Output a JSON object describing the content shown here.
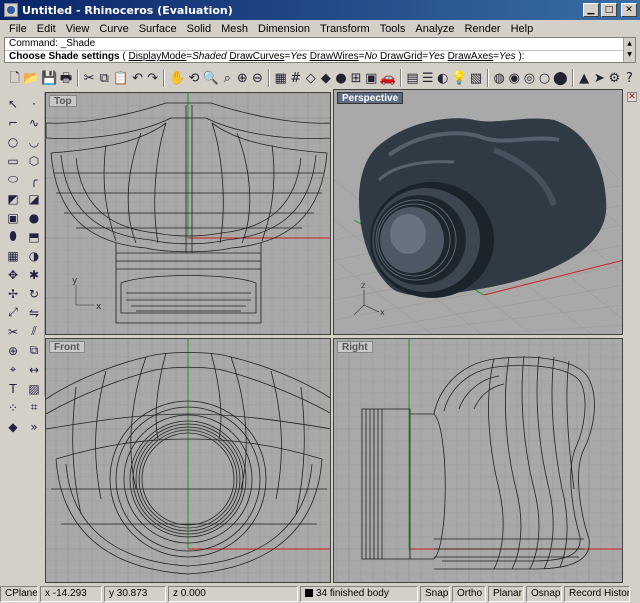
{
  "window": {
    "title": "Untitled - Rhinoceros (Evaluation)"
  },
  "menu": [
    "File",
    "Edit",
    "View",
    "Curve",
    "Surface",
    "Solid",
    "Mesh",
    "Dimension",
    "Transform",
    "Tools",
    "Analyze",
    "Render",
    "Help"
  ],
  "command": {
    "history": "Command: _Shade",
    "prompt_label": "Choose Shade settings",
    "options": [
      {
        "name": "DisplayMode",
        "value": "Shaded"
      },
      {
        "name": "DrawCurves",
        "value": "Yes"
      },
      {
        "name": "DrawWires",
        "value": "No"
      },
      {
        "name": "DrawGrid",
        "value": "Yes"
      },
      {
        "name": "DrawAxes",
        "value": "Yes"
      }
    ]
  },
  "toolbar": {
    "icons": [
      "new-icon",
      "open-icon",
      "save-icon",
      "print-icon",
      "sep",
      "cut-icon",
      "copy-icon",
      "paste-icon",
      "undo-icon",
      "redo-icon",
      "sep",
      "pan-icon",
      "rotate-view-icon",
      "zoom-icon",
      "zoom-window-icon",
      "zoom-extents-icon",
      "zoom-selected-icon",
      "sep",
      "layout-icon",
      "grid-icon",
      "wireframe-icon",
      "shaded-icon",
      "rendered-icon",
      "cplane-icon",
      "named-view-icon",
      "car-icon",
      "sep",
      "layer-icon",
      "properties-icon",
      "color-icon",
      "light-icon",
      "texture-icon",
      "sep",
      "color-wheel-icon",
      "sphere-icon",
      "material-icon",
      "environment-icon",
      "render-icon",
      "sep",
      "object-icon",
      "pointer-icon",
      "settings-icon",
      "help-icon"
    ]
  },
  "viewports": {
    "top": {
      "label": "Top"
    },
    "perspective": {
      "label": "Perspective"
    },
    "front": {
      "label": "Front"
    },
    "right": {
      "label": "Right"
    },
    "axis_x": "x",
    "axis_y": "y",
    "axis_z": "z"
  },
  "status": {
    "cplane": "CPlane",
    "x": "x -14.293",
    "y": "y 30.873",
    "z": "z 0.000",
    "selection": "34 finished body",
    "snap": "Snap",
    "ortho": "Ortho",
    "planar": "Planar",
    "osnap": "Osnap",
    "record": "Record History"
  },
  "colors": {
    "viewport_bg": "#a9a9a9",
    "grid": "#9a9a9a",
    "grid_major": "#8a8a8a",
    "x_axis": "#c8201e",
    "y_axis": "#1e9b1e",
    "wire": "#202020",
    "model": "#2f3a44"
  }
}
